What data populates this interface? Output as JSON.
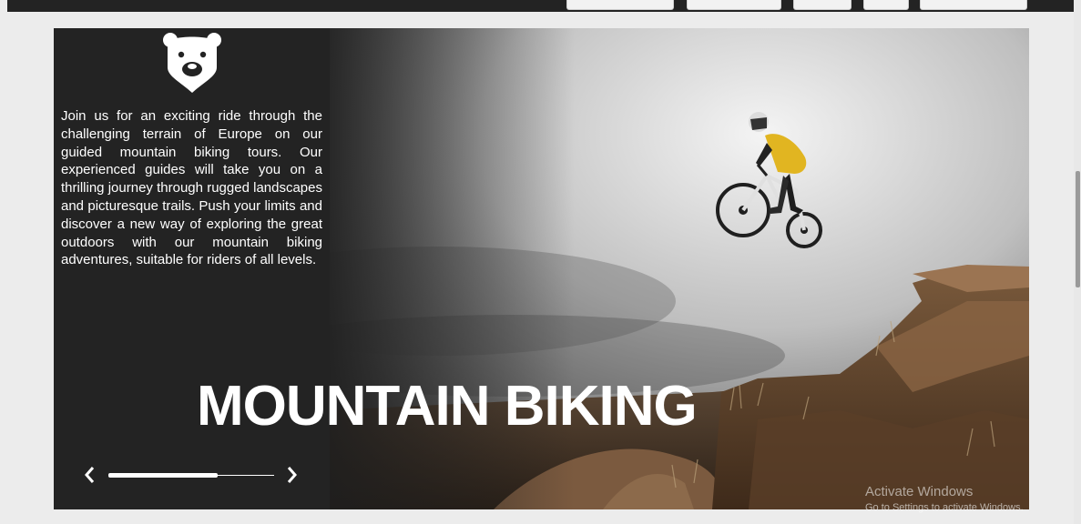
{
  "theme": {
    "sidebar_bg": "#232323",
    "text": "#ffffff",
    "page_bg": "#ececec"
  },
  "logo": {
    "icon": "bear-head-icon"
  },
  "intro": {
    "text": "Join us for an exciting ride through the challenging terrain of Europe on our guided mountain biking tours. Our experienced guides will take you on a thrilling journey through rugged landscapes and picturesque trails. Push your limits and discover a new way of exploring the great outdoors with our mountain biking adventures, suitable for riders of all levels."
  },
  "hero": {
    "title": "MOUNTAIN BIKING",
    "image_alt": "mountain biker jumping over rocky terrain"
  },
  "slider": {
    "prev_icon": "chevron-left-icon",
    "next_icon": "chevron-right-icon",
    "progress_fraction": 0.66
  },
  "watermark": {
    "title": "Activate Windows",
    "subtitle": "Go to Settings to activate Windows."
  }
}
